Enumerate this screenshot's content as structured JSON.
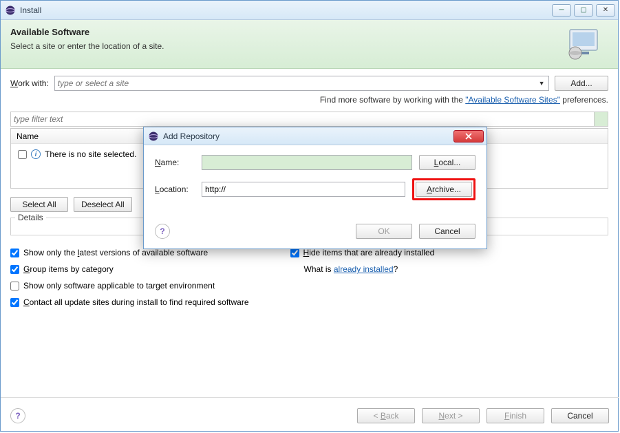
{
  "window": {
    "title": "Install"
  },
  "banner": {
    "title": "Available Software",
    "subtitle": "Select a site or enter the location of a site."
  },
  "work": {
    "label": "Work with:",
    "placeholder": "type or select a site",
    "add": "Add..."
  },
  "helper": {
    "prefix": "Find more software by working with the ",
    "link": "\"Available Software Sites\"",
    "suffix": " preferences."
  },
  "filter": {
    "placeholder": "type filter text"
  },
  "table": {
    "header": "Name",
    "message": "There is no site selected."
  },
  "buttons": {
    "selectAll": "Select All",
    "deselectAll": "Deselect All"
  },
  "details": {
    "label": "Details"
  },
  "checks": {
    "latest": "Show only the latest versions of available software",
    "group": "Group items by category",
    "target": "Show only software applicable to target environment",
    "contact": "Contact all update sites during install to find required software",
    "hide": "Hide items that are already installed",
    "whatis": "What is ",
    "already": "already installed",
    "q": "?"
  },
  "footer": {
    "back": "< Back",
    "next": "Next >",
    "finish": "Finish",
    "cancel": "Cancel"
  },
  "dialog": {
    "title": "Add Repository",
    "name": "Name:",
    "nameVal": "",
    "local": "Local...",
    "loc": "Location:",
    "locVal": "http://",
    "archive": "Archive...",
    "ok": "OK",
    "cancel": "Cancel"
  }
}
